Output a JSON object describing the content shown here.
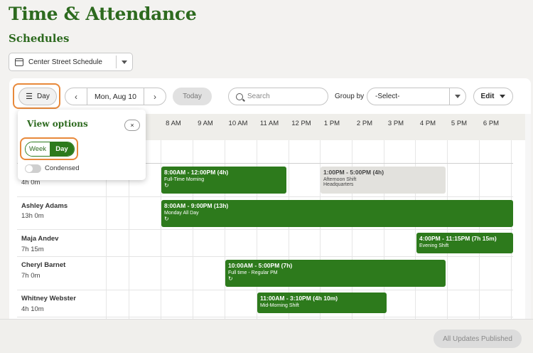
{
  "header": {
    "title": "Time & Attendance",
    "section": "Schedules"
  },
  "schedule_select": {
    "value": "Center Street Schedule"
  },
  "toolbar": {
    "view_button": "Day",
    "date_label": "Mon, Aug 10",
    "prev": "‹",
    "next": "›",
    "today": "Today",
    "search_placeholder": "Search",
    "group_by_label": "Group by",
    "group_by_value": "-Select-",
    "edit": "Edit"
  },
  "time_ticks": [
    "8 AM",
    "9 AM",
    "10 AM",
    "11 AM",
    "12 PM",
    "1 PM",
    "2 PM",
    "3 PM",
    "4 PM",
    "5 PM",
    "6 PM"
  ],
  "view_options": {
    "title": "View options",
    "close": "×",
    "week": "Week",
    "day": "Day",
    "condensed": "Condensed"
  },
  "employees": [
    {
      "name": "",
      "hours": "4h 0m"
    },
    {
      "name": "Ashley Adams",
      "hours": "13h 0m"
    },
    {
      "name": "Maja Andev",
      "hours": "7h 15m"
    },
    {
      "name": "Cheryl Barnet",
      "hours": "7h 0m"
    },
    {
      "name": "Whitney Webster",
      "hours": "4h 10m"
    }
  ],
  "shifts": [
    {
      "time": "8:00AM - 12:00PM (4h)",
      "label": "Full-Time Morning",
      "repeat": "↻"
    },
    {
      "time": "1:00PM - 5:00PM (4h)",
      "label": "Afternoon Shift",
      "location": "Headquarters"
    },
    {
      "time": "8:00AM - 9:00PM (13h)",
      "label": "Monday All Day",
      "repeat": "↻"
    },
    {
      "time": "4:00PM - 11:15PM (7h 15m)",
      "label": "Evening Shift"
    },
    {
      "time": "10:00AM - 5:00PM (7h)",
      "label": "Full time - Regular PM",
      "repeat": "↻"
    },
    {
      "time": "11:00AM - 3:10PM (4h 10m)",
      "label": "Mid-Morning Shift"
    }
  ],
  "footer": {
    "publish": "All Updates Published"
  },
  "colors": {
    "brand": "#2d6a1f",
    "shift_green": "#2d7a1c",
    "highlight": "#e8893b"
  }
}
